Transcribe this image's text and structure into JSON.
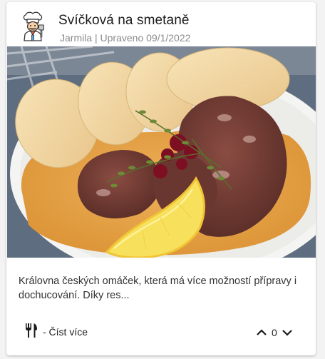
{
  "recipe": {
    "title": "Svíčková na smetaně",
    "subtitle": "Jarmila | Upraveno 09/1/2022",
    "description": "Královna českých omáček, která má více možností přípravy i dochucování. Díky res...",
    "read_more_label": "- Číst více",
    "vote_count": "0"
  },
  "icons": {
    "avatar": "chef-avatar-icon",
    "read_more": "cutlery-icon",
    "upvote": "chevron-up-icon",
    "downvote": "chevron-down-icon"
  },
  "colors": {
    "sauce": "#e6a148",
    "meat": "#6e3b33",
    "lemon": "#f3d65a",
    "dumpling": "#f2d7a0"
  }
}
